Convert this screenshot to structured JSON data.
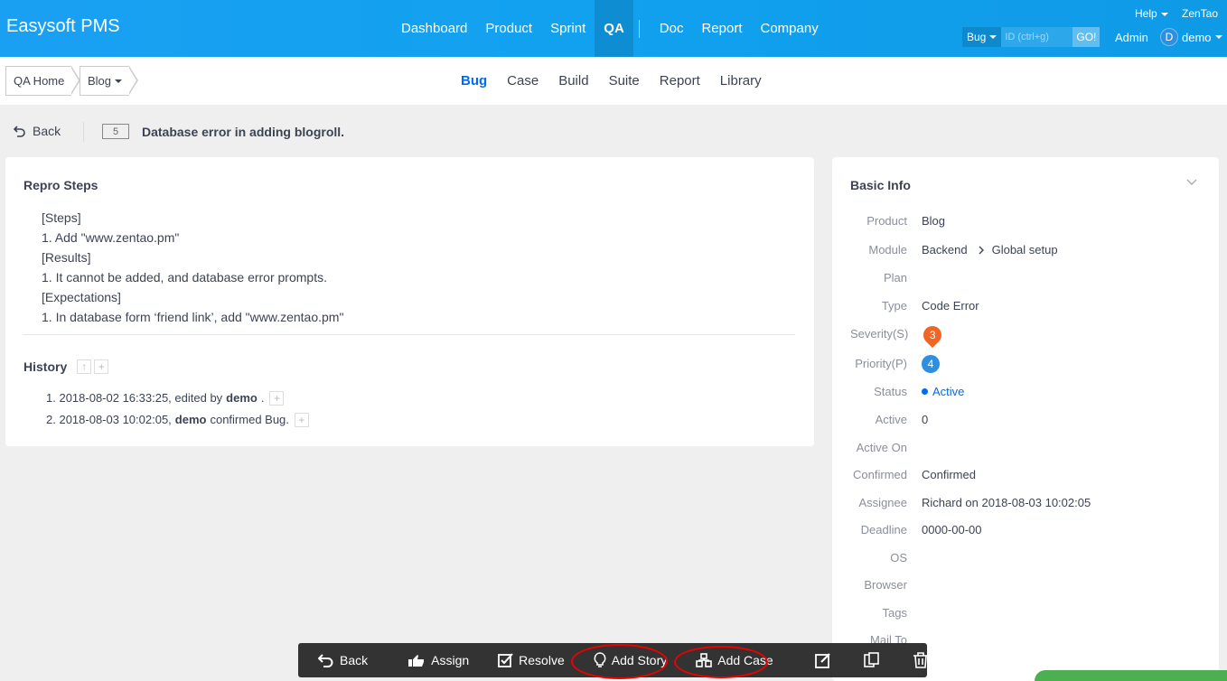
{
  "app": {
    "brand": "Easysoft PMS"
  },
  "mainnav": {
    "items": [
      "Dashboard",
      "Product",
      "Sprint",
      "QA",
      "Doc",
      "Report",
      "Company"
    ],
    "active": "QA"
  },
  "topright": {
    "help": "Help",
    "zentao": "ZenTao",
    "search_type": "Bug",
    "search_placeholder": "ID (ctrl+g)",
    "go": "GO!",
    "admin": "Admin",
    "avatar_letter": "D",
    "user": "demo"
  },
  "breadcrumb": {
    "home": "QA Home",
    "product": "Blog"
  },
  "subnav": {
    "items": [
      "Bug",
      "Case",
      "Build",
      "Suite",
      "Report",
      "Library"
    ],
    "active": "Bug"
  },
  "bug": {
    "back": "Back",
    "id": "5",
    "title": "Database error in adding blogroll."
  },
  "repro": {
    "title": "Repro Steps",
    "lines": [
      "[Steps]",
      "1. Add \"www.zentao.pm\"",
      "[Results]",
      "1. It cannot be added, and database error prompts.",
      "[Expectations]",
      "1. In database form ‘friend link’, add \"www.zentao.pm\""
    ]
  },
  "history": {
    "title": "History",
    "entries": [
      {
        "num": "1.",
        "text": "2018-08-02 16:33:25, edited by",
        "user": "demo",
        "suffix": "."
      },
      {
        "num": "2.",
        "text": "2018-08-03 10:02:05,",
        "user": "demo",
        "suffix": "confirmed Bug."
      }
    ]
  },
  "basic": {
    "title": "Basic Info",
    "product": {
      "label": "Product",
      "value": "Blog"
    },
    "module": {
      "label": "Module",
      "value": "Backend",
      "sub": "Global setup"
    },
    "plan": {
      "label": "Plan",
      "value": ""
    },
    "type": {
      "label": "Type",
      "value": "Code Error"
    },
    "severity": {
      "label": "Severity(S)",
      "value": "3"
    },
    "priority": {
      "label": "Priority(P)",
      "value": "4"
    },
    "status": {
      "label": "Status",
      "value": "Active"
    },
    "active": {
      "label": "Active",
      "value": "0"
    },
    "active_on": {
      "label": "Active On",
      "value": ""
    },
    "confirmed": {
      "label": "Confirmed",
      "value": "Confirmed"
    },
    "assignee": {
      "label": "Assignee",
      "value": "Richard on 2018-08-03 10:02:05"
    },
    "deadline": {
      "label": "Deadline",
      "value": "0000-00-00"
    },
    "os": {
      "label": "OS",
      "value": ""
    },
    "browser": {
      "label": "Browser",
      "value": ""
    },
    "tags": {
      "label": "Tags",
      "value": ""
    },
    "mailto": {
      "label": "Mail To",
      "value": ""
    }
  },
  "actions": {
    "back": "Back",
    "assign": "Assign",
    "resolve": "Resolve",
    "add_story": "Add Story",
    "add_case": "Add Case"
  },
  "colors": {
    "brand": "#11a1ef",
    "accent": "#006af1",
    "severity": "#ef6524",
    "priority": "#2e8fe0",
    "highlight": "#ee0000"
  }
}
